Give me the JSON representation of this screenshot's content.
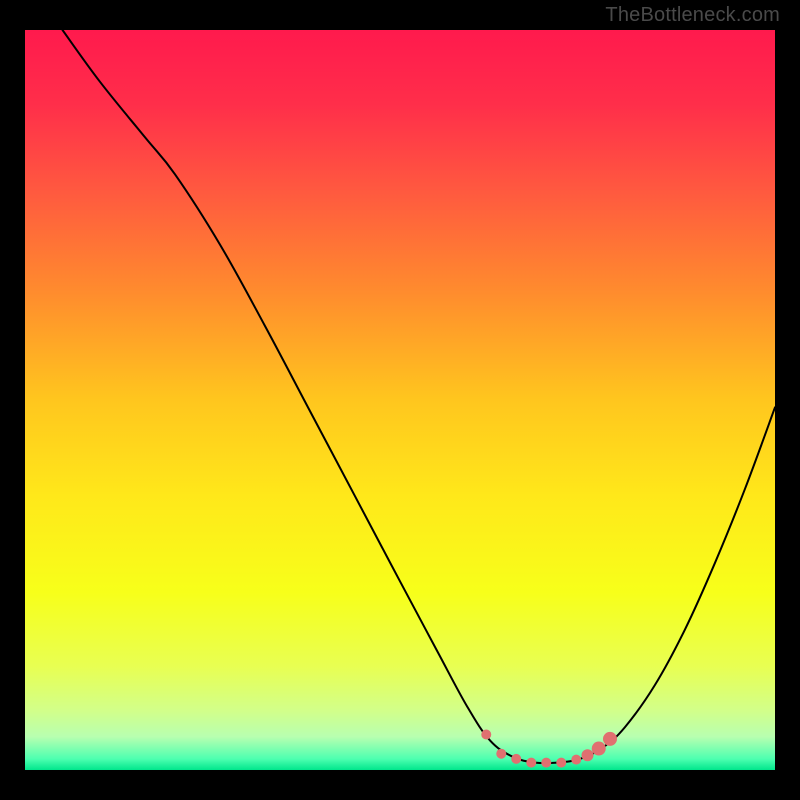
{
  "watermark": {
    "text": "TheBottleneck.com"
  },
  "frame": {
    "outer_w": 800,
    "outer_h": 800,
    "margin_left": 25,
    "margin_right": 25,
    "margin_top": 30,
    "margin_bottom": 30
  },
  "gradient": {
    "stops": [
      {
        "offset": 0.0,
        "color": "#ff1a4d"
      },
      {
        "offset": 0.1,
        "color": "#ff2e4a"
      },
      {
        "offset": 0.22,
        "color": "#ff5a3f"
      },
      {
        "offset": 0.35,
        "color": "#ff8a2e"
      },
      {
        "offset": 0.5,
        "color": "#ffc61e"
      },
      {
        "offset": 0.63,
        "color": "#ffe81a"
      },
      {
        "offset": 0.76,
        "color": "#f7ff1a"
      },
      {
        "offset": 0.86,
        "color": "#e8ff52"
      },
      {
        "offset": 0.92,
        "color": "#d2ff8a"
      },
      {
        "offset": 0.955,
        "color": "#b8ffb0"
      },
      {
        "offset": 0.985,
        "color": "#4dffb0"
      },
      {
        "offset": 1.0,
        "color": "#00e68c"
      }
    ]
  },
  "marker_color": "#e07070",
  "chart_data": {
    "type": "line",
    "title": "",
    "xlabel": "",
    "ylabel": "",
    "xlim": [
      0,
      100
    ],
    "ylim": [
      0,
      100
    ],
    "series": [
      {
        "name": "curve",
        "points": [
          {
            "x": 5.0,
            "y": 100.0
          },
          {
            "x": 10.0,
            "y": 93.0
          },
          {
            "x": 16.0,
            "y": 85.5
          },
          {
            "x": 20.0,
            "y": 80.5
          },
          {
            "x": 26.0,
            "y": 71.0
          },
          {
            "x": 32.0,
            "y": 60.0
          },
          {
            "x": 38.0,
            "y": 48.5
          },
          {
            "x": 44.0,
            "y": 37.0
          },
          {
            "x": 50.0,
            "y": 25.5
          },
          {
            "x": 55.0,
            "y": 16.0
          },
          {
            "x": 59.0,
            "y": 8.5
          },
          {
            "x": 62.0,
            "y": 4.0
          },
          {
            "x": 65.0,
            "y": 1.8
          },
          {
            "x": 68.0,
            "y": 1.0
          },
          {
            "x": 71.0,
            "y": 1.0
          },
          {
            "x": 74.0,
            "y": 1.5
          },
          {
            "x": 77.0,
            "y": 3.0
          },
          {
            "x": 80.0,
            "y": 5.8
          },
          {
            "x": 84.0,
            "y": 11.5
          },
          {
            "x": 88.0,
            "y": 19.0
          },
          {
            "x": 92.0,
            "y": 28.0
          },
          {
            "x": 96.0,
            "y": 38.0
          },
          {
            "x": 100.0,
            "y": 49.0
          }
        ]
      }
    ],
    "markers": [
      {
        "x": 61.5,
        "y": 4.8,
        "r": 5
      },
      {
        "x": 63.5,
        "y": 2.2,
        "r": 5
      },
      {
        "x": 65.5,
        "y": 1.5,
        "r": 5
      },
      {
        "x": 67.5,
        "y": 1.0,
        "r": 5
      },
      {
        "x": 69.5,
        "y": 1.0,
        "r": 5
      },
      {
        "x": 71.5,
        "y": 1.0,
        "r": 5
      },
      {
        "x": 73.5,
        "y": 1.4,
        "r": 5
      },
      {
        "x": 75.0,
        "y": 2.0,
        "r": 6
      },
      {
        "x": 76.5,
        "y": 2.9,
        "r": 7
      },
      {
        "x": 78.0,
        "y": 4.2,
        "r": 7
      }
    ]
  }
}
